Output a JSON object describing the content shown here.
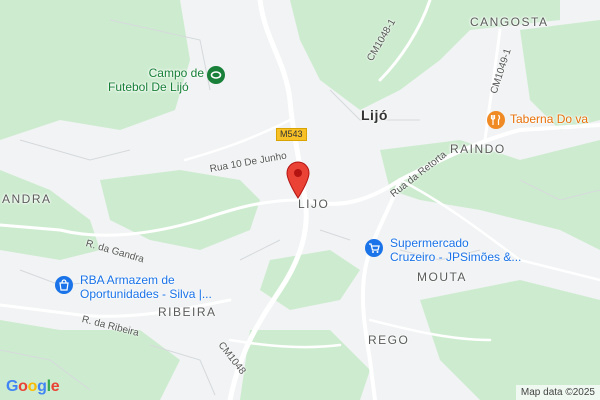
{
  "map": {
    "places": {
      "lijo_bold": "Lijó",
      "lijo": "LIJO",
      "cangosta": "CANGOSTA",
      "raindo": "RAINDO",
      "mouta": "MOUTA",
      "ribeira": "RIBEIRA",
      "rego": "REGO",
      "andra": "ANDRA"
    },
    "roads": {
      "m543": "M543",
      "rua_10_junho": "Rua 10 De Junho",
      "rua_retorta": "Rua da Retorta",
      "r_gandra": "R. da Gandra",
      "r_ribeira": "R. da Ribeira",
      "cm1048": "CM1048",
      "cm1048_1": "CM1048-1",
      "cm1049_1": "CM1049-1"
    },
    "pois": {
      "campo_line1": "Campo de",
      "campo_line2": "Futebol De Lijó",
      "taberna": "Taberna Do va",
      "super_line1": "Supermercado",
      "super_line2": "Cruzeiro - JPSimões &...",
      "rba_line1": "RBA Armazem de",
      "rba_line2": "Oportunidades - Silva |..."
    },
    "icons": {
      "pin": "location-pin-icon",
      "stadium": "stadium-icon",
      "restaurant": "fork-knife-icon",
      "shopping": "shopping-cart-icon",
      "store": "shopping-bag-icon"
    },
    "colors": {
      "park": "#cdeccf",
      "road": "#ffffff",
      "pin": "#ea4335",
      "poi_green": "#188038",
      "poi_blue": "#1a73e8",
      "poi_orange": "#e8710a"
    },
    "logo": "Google",
    "attribution": "Map data ©2025"
  }
}
